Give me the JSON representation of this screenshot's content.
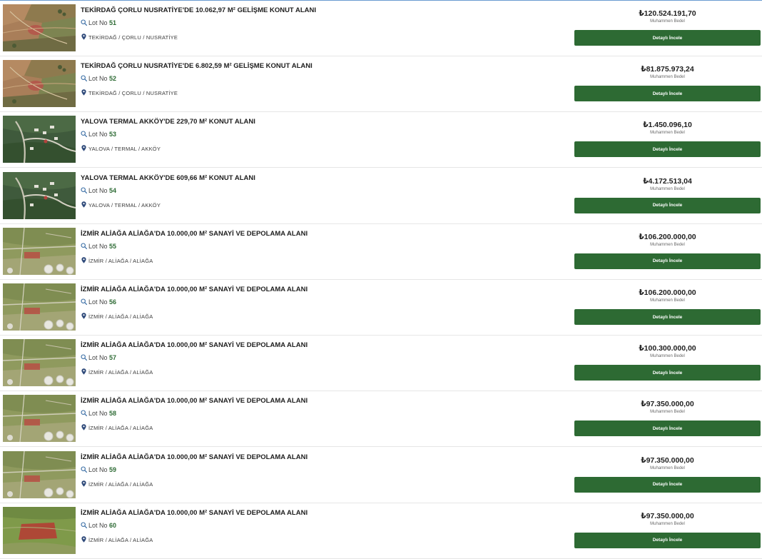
{
  "labels": {
    "lot_prefix": "Lot No",
    "price_caption": "Muhammen Bedel",
    "detail_button": "Detaylı İncele"
  },
  "colors": {
    "button_bg": "#2d6a33",
    "lot_number": "#2e6b35"
  },
  "listings": [
    {
      "title": "TEKİRDAĞ ÇORLU NUSRATİYE'DE 10.062,97 M² GELİŞME KONUT ALANI",
      "lot_no": "51",
      "location": "TEKİRDAĞ / ÇORLU / NUSRATİYE",
      "price": "₺120.524.191,70",
      "thumb_type": "farmland"
    },
    {
      "title": "TEKİRDAĞ ÇORLU NUSRATİYE'DE 6.802,59 M² GELİŞME KONUT ALANI",
      "lot_no": "52",
      "location": "TEKİRDAĞ / ÇORLU / NUSRATİYE",
      "price": "₺81.875.973,24",
      "thumb_type": "farmland"
    },
    {
      "title": "YALOVA TERMAL AKKÖY'DE 229,70 M² KONUT ALANI",
      "lot_no": "53",
      "location": "YALOVA / TERMAL / AKKÖY",
      "price": "₺1.450.096,10",
      "thumb_type": "forest"
    },
    {
      "title": "YALOVA TERMAL AKKÖY'DE 609,66 M² KONUT ALANI",
      "lot_no": "54",
      "location": "YALOVA / TERMAL / AKKÖY",
      "price": "₺4.172.513,04",
      "thumb_type": "forest"
    },
    {
      "title": "İZMİR ALİAĞA ALİAĞA'DA 10.000,00 M² SANAYİ VE DEPOLAMA ALANI",
      "lot_no": "55",
      "location": "İZMİR / ALİAĞA / ALİAĞA",
      "price": "₺106.200.000,00",
      "thumb_type": "industrial"
    },
    {
      "title": "İZMİR ALİAĞA ALİAĞA'DA 10.000,00 M² SANAYİ VE DEPOLAMA ALANI",
      "lot_no": "56",
      "location": "İZMİR / ALİAĞA / ALİAĞA",
      "price": "₺106.200.000,00",
      "thumb_type": "industrial"
    },
    {
      "title": "İZMİR ALİAĞA ALİAĞA'DA 10.000,00 M² SANAYİ VE DEPOLAMA ALANI",
      "lot_no": "57",
      "location": "İZMİR / ALİAĞA / ALİAĞA",
      "price": "₺100.300.000,00",
      "thumb_type": "industrial"
    },
    {
      "title": "İZMİR ALİAĞA ALİAĞA'DA 10.000,00 M² SANAYİ VE DEPOLAMA ALANI",
      "lot_no": "58",
      "location": "İZMİR / ALİAĞA / ALİAĞA",
      "price": "₺97.350.000,00",
      "thumb_type": "industrial"
    },
    {
      "title": "İZMİR ALİAĞA ALİAĞA'DA 10.000,00 M² SANAYİ VE DEPOLAMA ALANI",
      "lot_no": "59",
      "location": "İZMİR / ALİAĞA / ALİAĞA",
      "price": "₺97.350.000,00",
      "thumb_type": "industrial"
    },
    {
      "title": "İZMİR ALİAĞA ALİAĞA'DA 10.000,00 M² SANAYİ VE DEPOLAMA ALANI",
      "lot_no": "60",
      "location": "İZMİR / ALİAĞA / ALİAĞA",
      "price": "₺97.350.000,00",
      "thumb_type": "field"
    }
  ]
}
